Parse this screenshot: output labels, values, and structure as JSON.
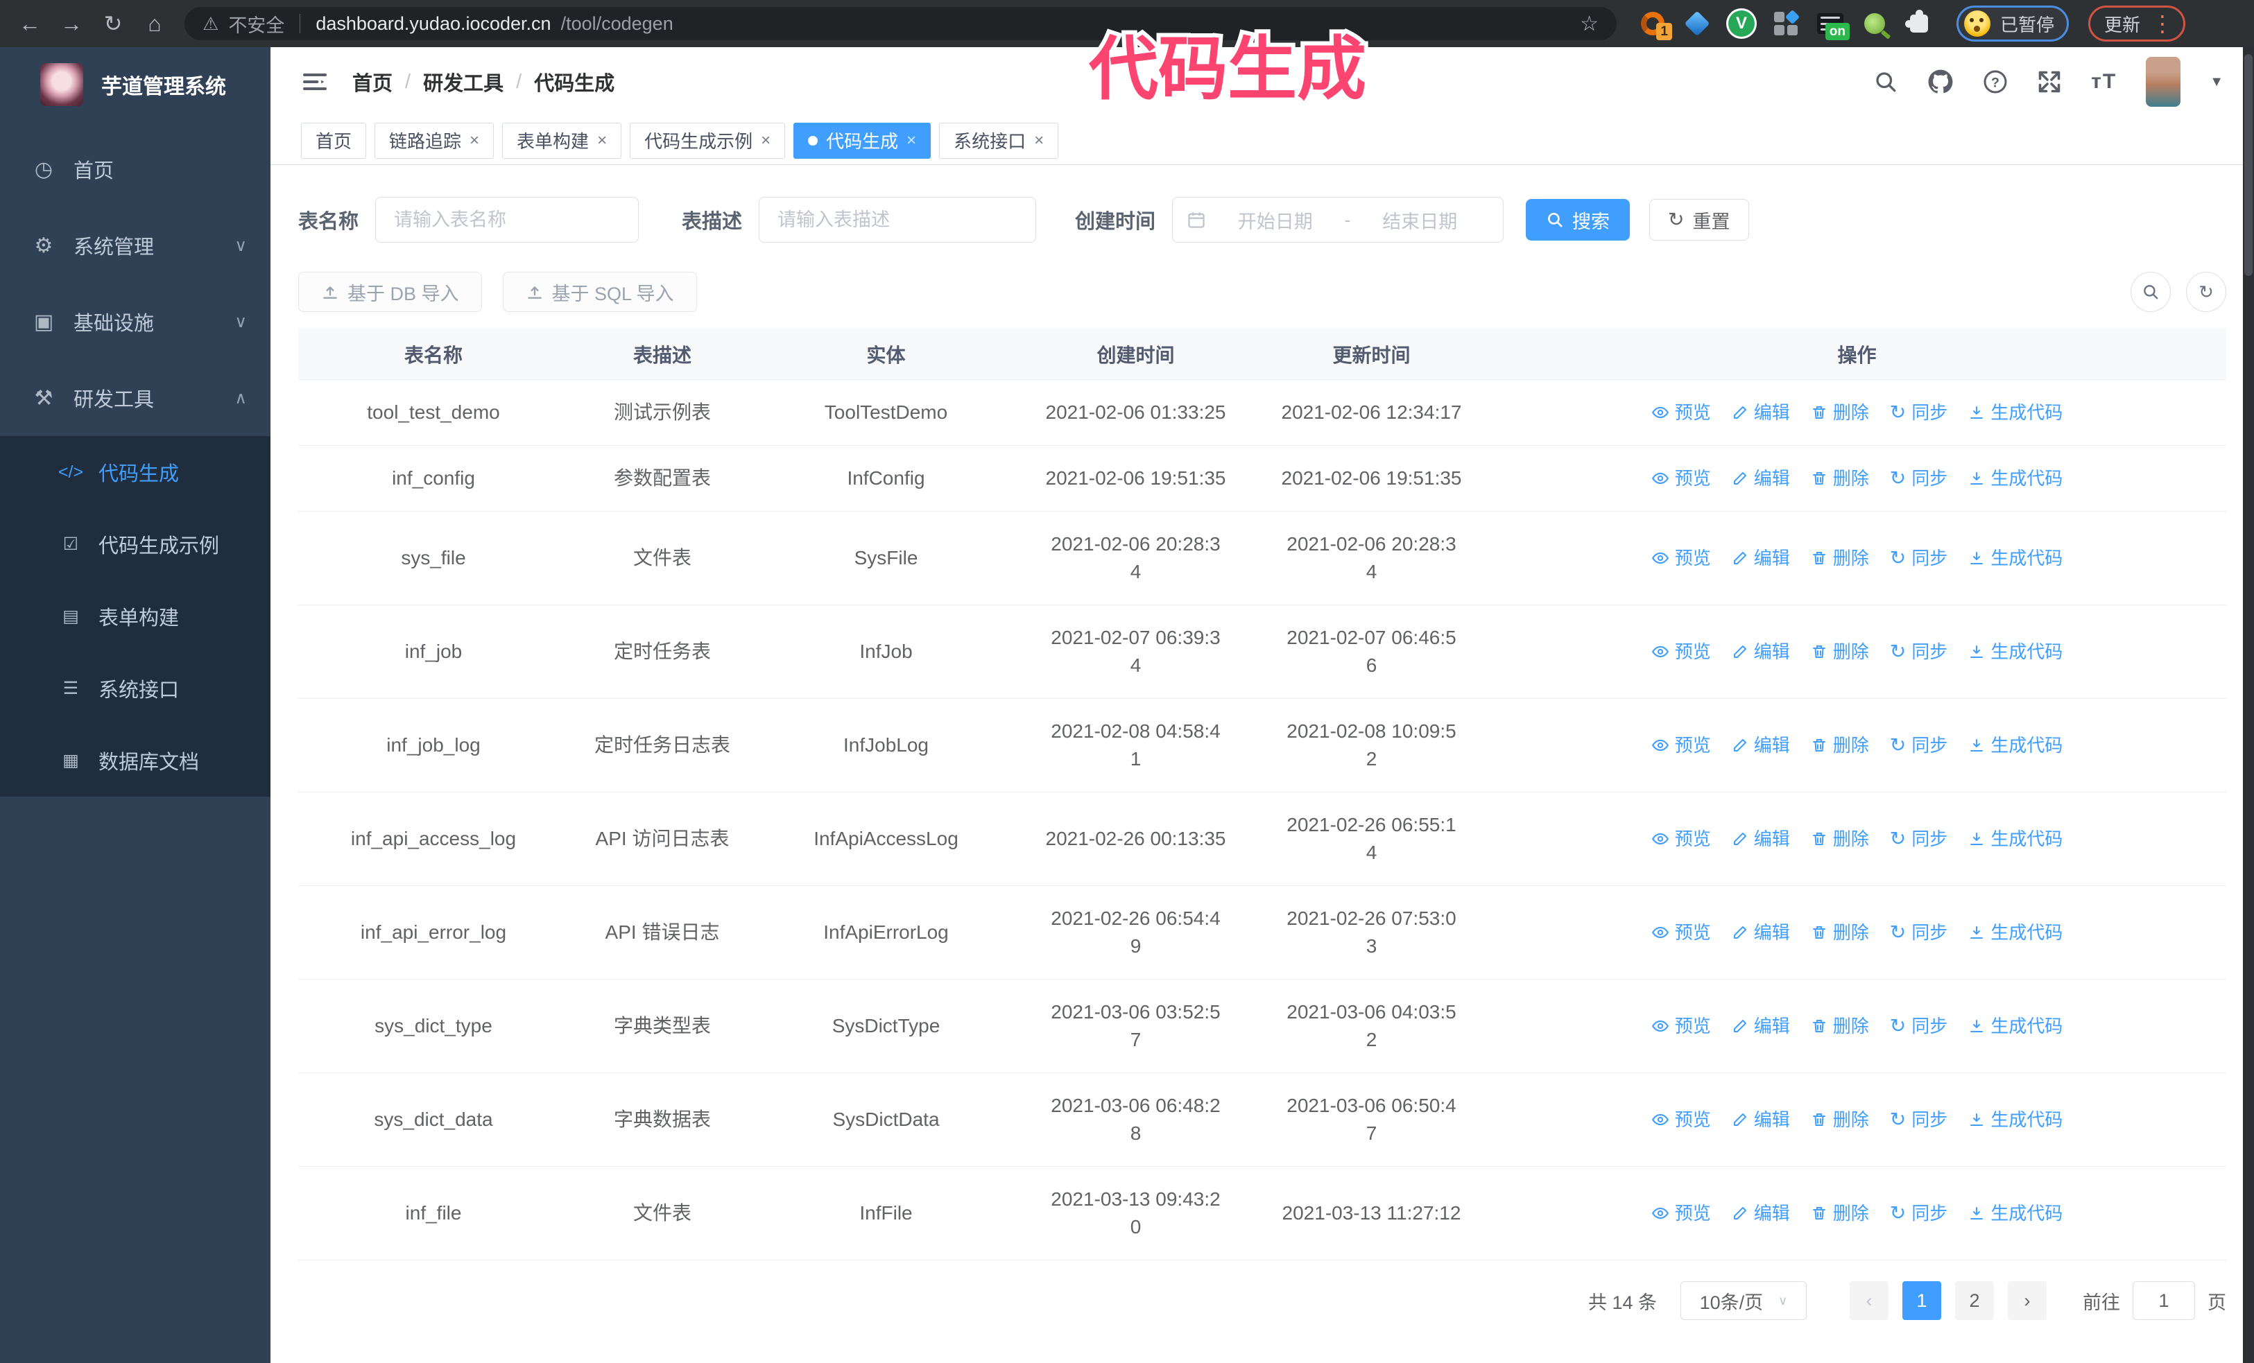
{
  "browser": {
    "security_label": "不安全",
    "url_host": "dashboard.yudao.iocoder.cn",
    "url_path": "/tool/codegen",
    "ext_badge_count": "1",
    "ext_badge_on": "on",
    "profile_paused_label": "已暂停",
    "update_label": "更新"
  },
  "overlay": {
    "title": "代码生成",
    "color": "#fb4570"
  },
  "sidebar": {
    "app_title": "芋道管理系统",
    "items": [
      {
        "icon": "dashboard-icon",
        "icon_glyph": "◷",
        "label": "首页",
        "chevron": ""
      },
      {
        "icon": "gear-icon",
        "icon_glyph": "⚙",
        "label": "系统管理",
        "chevron": "∨"
      },
      {
        "icon": "monitor-icon",
        "icon_glyph": "▣",
        "label": "基础设施",
        "chevron": "∨"
      },
      {
        "icon": "toolbox-icon",
        "icon_glyph": "⚒",
        "label": "研发工具",
        "chevron": "∧"
      }
    ],
    "sub_items": [
      {
        "icon": "code-icon",
        "icon_glyph": "</>",
        "label": "代码生成",
        "active": true
      },
      {
        "icon": "shield-check-icon",
        "icon_glyph": "☑",
        "label": "代码生成示例"
      },
      {
        "icon": "form-icon",
        "icon_glyph": "▤",
        "label": "表单构建"
      },
      {
        "icon": "sliders-icon",
        "icon_glyph": "☰",
        "label": "系统接口"
      },
      {
        "icon": "database-icon",
        "icon_glyph": "▦",
        "label": "数据库文档"
      }
    ]
  },
  "header": {
    "separator": "/",
    "breadcrumb": [
      {
        "label": "首页"
      },
      {
        "label": "研发工具",
        "sep": true
      },
      {
        "label": "代码生成",
        "sep": true,
        "current": true
      }
    ]
  },
  "tabs": [
    {
      "label": "首页"
    },
    {
      "label": "链路追踪",
      "closable": true
    },
    {
      "label": "表单构建",
      "closable": true
    },
    {
      "label": "代码生成示例",
      "closable": true
    },
    {
      "label": "代码生成",
      "closable": true,
      "active": true
    },
    {
      "label": "系统接口",
      "closable": true
    }
  ],
  "filters": {
    "table_name_label": "表名称",
    "table_name_placeholder": "请输入表名称",
    "table_desc_label": "表描述",
    "table_desc_placeholder": "请输入表描述",
    "create_time_label": "创建时间",
    "date_start_placeholder": "开始日期",
    "date_separator": "-",
    "date_end_placeholder": "结束日期",
    "search_label": "搜索",
    "reset_label": "重置"
  },
  "toolbar": {
    "import_db_label": "基于 DB 导入",
    "import_sql_label": "基于 SQL 导入"
  },
  "table": {
    "columns": {
      "name": "表名称",
      "desc": "表描述",
      "entity": "实体",
      "created": "创建时间",
      "updated": "更新时间",
      "actions": "操作"
    },
    "row_actions": [
      {
        "label": "预览"
      },
      {
        "label": "编辑"
      },
      {
        "label": "删除"
      },
      {
        "label": "同步"
      },
      {
        "label": "生成代码"
      }
    ],
    "rows": [
      {
        "name": "tool_test_demo",
        "desc": "测试示例表",
        "entity": "ToolTestDemo",
        "created": "2021-02-06 01:33:25",
        "updated": "2021-02-06 12:34:17"
      },
      {
        "name": "inf_config",
        "desc": "参数配置表",
        "entity": "InfConfig",
        "created": "2021-02-06 19:51:35",
        "updated": "2021-02-06 19:51:35"
      },
      {
        "name": "sys_file",
        "desc": "文件表",
        "entity": "SysFile",
        "created": "2021-02-06 20:28:3\n4",
        "updated": "2021-02-06 20:28:3\n4"
      },
      {
        "name": "inf_job",
        "desc": "定时任务表",
        "entity": "InfJob",
        "created": "2021-02-07 06:39:3\n4",
        "updated": "2021-02-07 06:46:5\n6"
      },
      {
        "name": "inf_job_log",
        "desc": "定时任务日志表",
        "entity": "InfJobLog",
        "created": "2021-02-08 04:58:4\n1",
        "updated": "2021-02-08 10:09:5\n2"
      },
      {
        "name": "inf_api_access_log",
        "desc": "API 访问日志表",
        "entity": "InfApiAccessLog",
        "created": "2021-02-26 00:13:35",
        "updated": "2021-02-26 06:55:1\n4"
      },
      {
        "name": "inf_api_error_log",
        "desc": "API 错误日志",
        "entity": "InfApiErrorLog",
        "created": "2021-02-26 06:54:4\n9",
        "updated": "2021-02-26 07:53:0\n3"
      },
      {
        "name": "sys_dict_type",
        "desc": "字典类型表",
        "entity": "SysDictType",
        "created": "2021-03-06 03:52:5\n7",
        "updated": "2021-03-06 04:03:5\n2"
      },
      {
        "name": "sys_dict_data",
        "desc": "字典数据表",
        "entity": "SysDictData",
        "created": "2021-03-06 06:48:2\n8",
        "updated": "2021-03-06 06:50:4\n7"
      },
      {
        "name": "inf_file",
        "desc": "文件表",
        "entity": "InfFile",
        "created": "2021-03-13 09:43:2\n0",
        "updated": "2021-03-13 11:27:12"
      }
    ]
  },
  "pagination": {
    "total_label": "共 14 条",
    "page_size_label": "10条/页",
    "prev_icon": "‹",
    "next_icon": "›",
    "pages": [
      {
        "label": "1",
        "active": true
      },
      {
        "label": "2"
      }
    ],
    "jump_prefix": "前往",
    "jump_value": "1",
    "jump_suffix": "页"
  }
}
